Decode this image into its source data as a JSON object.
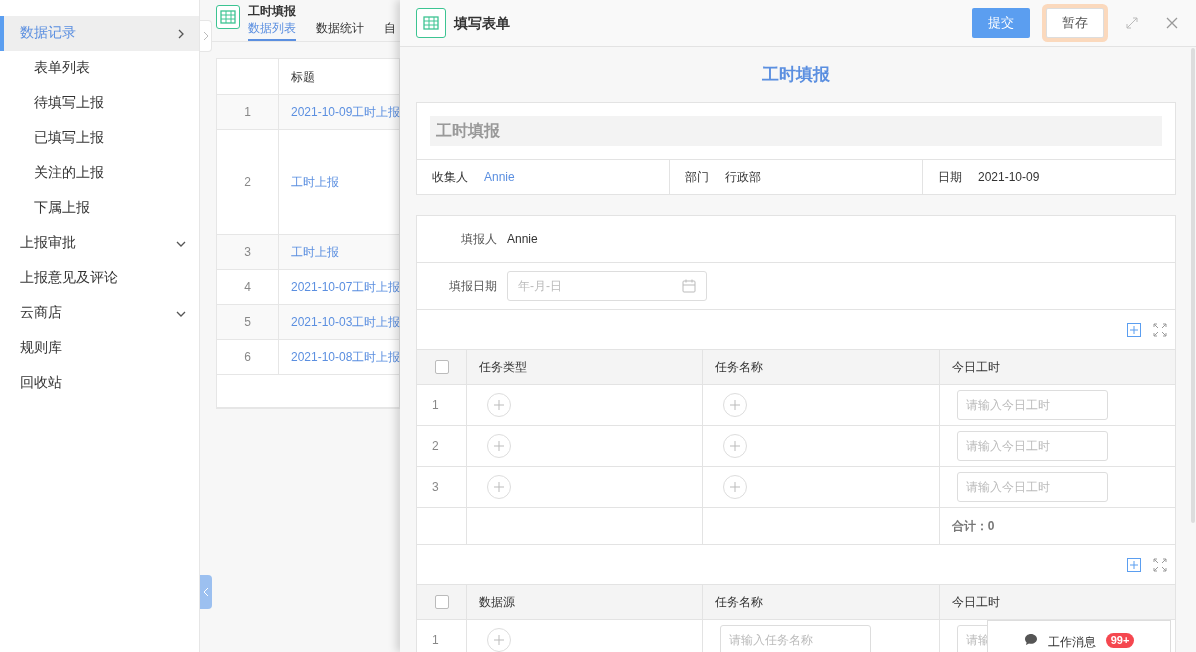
{
  "sidebar": {
    "items": [
      {
        "label": "数据记录",
        "selected": true,
        "expanded": true,
        "children": [
          {
            "label": "表单列表",
            "selected": false
          },
          {
            "label": "待填写上报",
            "selected": false
          },
          {
            "label": "已填写上报",
            "selected": false
          },
          {
            "label": "关注的上报",
            "selected": false
          },
          {
            "label": "下属上报",
            "selected": false
          }
        ]
      },
      {
        "label": "上报审批",
        "selected": false,
        "expanded": false
      },
      {
        "label": "上报意见及评论",
        "selected": false
      },
      {
        "label": "云商店",
        "selected": false,
        "expanded": false
      },
      {
        "label": "规则库",
        "selected": false
      },
      {
        "label": "回收站",
        "selected": false
      }
    ]
  },
  "list_panel": {
    "title": "工时填报",
    "tabs": [
      {
        "label": "数据列表",
        "selected": true
      },
      {
        "label": "数据统计",
        "selected": false
      },
      {
        "label": "自",
        "selected": false
      }
    ],
    "table": {
      "columns": [
        "标题"
      ],
      "rows": [
        {
          "index": "1",
          "title": "2021-10-09工时上报"
        },
        {
          "index": "2",
          "title": "工时上报"
        },
        {
          "index": "3",
          "title": "工时上报"
        },
        {
          "index": "4",
          "title": "2021-10-07工时上报"
        },
        {
          "index": "5",
          "title": "2021-10-03工时上报"
        },
        {
          "index": "6",
          "title": "2021-10-08工时上报"
        }
      ]
    }
  },
  "drawer": {
    "title": "填写表单",
    "buttons": [
      {
        "label": "提交",
        "kind": "primary",
        "focused": false
      },
      {
        "label": "暂存",
        "kind": "secondary",
        "focused": true
      }
    ],
    "form_heading": "工时填报",
    "form_title": "工时填报",
    "info": [
      {
        "label": "收集人",
        "value": "Annie",
        "link": true
      },
      {
        "label": "部门",
        "value": "行政部",
        "link": false
      },
      {
        "label": "日期",
        "value": "2021-10-09",
        "link": false
      }
    ],
    "fields": [
      {
        "label": "填报人",
        "kind": "text",
        "value": "Annie"
      },
      {
        "label": "填报日期",
        "kind": "date",
        "placeholder": "年-月-日"
      }
    ],
    "subtables": [
      {
        "checked": false,
        "columns": [
          {
            "label": "任务类型",
            "kind": "picker"
          },
          {
            "label": "任务名称",
            "kind": "picker"
          },
          {
            "label": "今日工时",
            "kind": "input"
          }
        ],
        "rows": [
          {
            "index": "1",
            "placeholders": [
              "请输入今日工时"
            ]
          },
          {
            "index": "2",
            "placeholders": [
              "请输入今日工时"
            ]
          },
          {
            "index": "3",
            "placeholders": [
              "请输入今日工时"
            ]
          }
        ],
        "total": "合计：0"
      },
      {
        "checked": false,
        "columns": [
          {
            "label": "数据源",
            "kind": "picker"
          },
          {
            "label": "任务名称",
            "kind": "input"
          },
          {
            "label": "今日工时",
            "kind": "input"
          }
        ],
        "rows": [
          {
            "index": "1",
            "placeholders": [
              "请输入任务名称",
              "请输"
            ]
          }
        ]
      }
    ]
  },
  "message_widget": {
    "label": "工作消息",
    "badge": "99+"
  }
}
